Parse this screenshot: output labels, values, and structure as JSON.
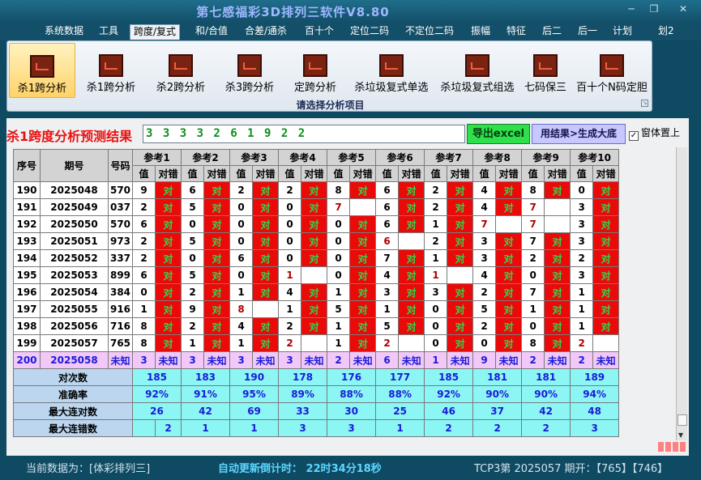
{
  "window": {
    "title": "第七感福彩3D排列三软件V8.80",
    "min": "─",
    "restore": "❐",
    "close": "✕"
  },
  "menu": [
    "系统数据",
    "工具",
    "跨度/复式",
    "和/合值",
    "合差/通杀",
    "百十个",
    "定位二码",
    "不定位二码",
    "振幅",
    "特征",
    "后二",
    "后一",
    "计划",
    "划2"
  ],
  "ribbon": {
    "items": [
      "杀1跨分析",
      "杀1跨分析",
      "杀2跨分析",
      "杀3跨分析",
      "定跨分析",
      "杀垃圾复式单选",
      "杀垃圾复式组选",
      "七码保三",
      "百十个N码定胆"
    ],
    "caption": "请选择分析项目",
    "icon": "chart-icon"
  },
  "result": {
    "title": "杀1跨度分析预测结果",
    "value": "3 3 3 3 2 6 1 9 2 2",
    "excel_label": "导出excel",
    "gen_label": "用结果>生成大底",
    "topmost_label": "窗体置上",
    "topmost_check": "✓"
  },
  "table": {
    "headers": {
      "seq": "序号",
      "issue": "期号",
      "num": "号码",
      "val": "值",
      "check": "对错"
    },
    "refs": [
      "参考1",
      "参考2",
      "参考3",
      "参考4",
      "参考5",
      "参考6",
      "参考7",
      "参考8",
      "参考9",
      "参考10"
    ],
    "hit_label": "对",
    "rows": [
      {
        "seq": "190",
        "issue": "2025048",
        "num": "570",
        "vals": [
          "9",
          "6",
          "2",
          "2",
          "8",
          "6",
          "2",
          "4",
          "8",
          "0"
        ],
        "hits": [
          1,
          1,
          1,
          1,
          1,
          1,
          1,
          1,
          1,
          1
        ]
      },
      {
        "seq": "191",
        "issue": "2025049",
        "num": "037",
        "vals": [
          "2",
          "5",
          "0",
          "0",
          "7",
          "6",
          "2",
          "4",
          "7",
          "3"
        ],
        "hits": [
          1,
          1,
          1,
          1,
          0,
          1,
          1,
          1,
          0,
          1
        ]
      },
      {
        "seq": "192",
        "issue": "2025050",
        "num": "570",
        "vals": [
          "6",
          "0",
          "0",
          "0",
          "0",
          "6",
          "1",
          "7",
          "7",
          "3"
        ],
        "hits": [
          1,
          1,
          1,
          1,
          1,
          1,
          1,
          0,
          0,
          1
        ]
      },
      {
        "seq": "193",
        "issue": "2025051",
        "num": "973",
        "vals": [
          "2",
          "5",
          "0",
          "0",
          "0",
          "6",
          "2",
          "3",
          "7",
          "3"
        ],
        "hits": [
          1,
          1,
          1,
          1,
          1,
          0,
          1,
          1,
          1,
          1
        ]
      },
      {
        "seq": "194",
        "issue": "2025052",
        "num": "337",
        "vals": [
          "2",
          "0",
          "6",
          "0",
          "0",
          "7",
          "1",
          "3",
          "2",
          "2"
        ],
        "hits": [
          1,
          1,
          1,
          1,
          1,
          1,
          1,
          1,
          1,
          1
        ]
      },
      {
        "seq": "195",
        "issue": "2025053",
        "num": "899",
        "vals": [
          "6",
          "5",
          "0",
          "1",
          "0",
          "4",
          "1",
          "4",
          "0",
          "3"
        ],
        "hits": [
          1,
          1,
          1,
          0,
          1,
          1,
          0,
          1,
          1,
          1
        ]
      },
      {
        "seq": "196",
        "issue": "2025054",
        "num": "384",
        "vals": [
          "0",
          "2",
          "1",
          "4",
          "1",
          "3",
          "3",
          "2",
          "7",
          "1"
        ],
        "hits": [
          1,
          1,
          1,
          1,
          1,
          1,
          1,
          1,
          1,
          1
        ]
      },
      {
        "seq": "197",
        "issue": "2025055",
        "num": "916",
        "vals": [
          "1",
          "9",
          "8",
          "1",
          "5",
          "1",
          "0",
          "5",
          "1",
          "1"
        ],
        "hits": [
          1,
          1,
          0,
          1,
          1,
          1,
          1,
          1,
          1,
          1
        ]
      },
      {
        "seq": "198",
        "issue": "2025056",
        "num": "716",
        "vals": [
          "8",
          "2",
          "4",
          "2",
          "1",
          "5",
          "0",
          "2",
          "0",
          "1"
        ],
        "hits": [
          1,
          1,
          1,
          1,
          1,
          1,
          1,
          1,
          1,
          1
        ]
      },
      {
        "seq": "199",
        "issue": "2025057",
        "num": "765",
        "vals": [
          "8",
          "1",
          "1",
          "2",
          "1",
          "2",
          "0",
          "0",
          "8",
          "2"
        ],
        "hits": [
          1,
          1,
          1,
          0,
          1,
          0,
          1,
          1,
          1,
          0
        ]
      }
    ],
    "pred": {
      "seq": "200",
      "issue": "2025058",
      "num": "未知",
      "vals": [
        "3",
        "3",
        "3",
        "3",
        "2",
        "6",
        "1",
        "9",
        "2",
        "2"
      ],
      "check": "未知"
    },
    "stats": [
      {
        "label": "对次数",
        "vals": [
          "185",
          "183",
          "190",
          "178",
          "176",
          "177",
          "185",
          "181",
          "181",
          "189"
        ]
      },
      {
        "label": "准确率",
        "vals": [
          "92%",
          "91%",
          "95%",
          "89%",
          "88%",
          "88%",
          "92%",
          "90%",
          "90%",
          "94%"
        ]
      },
      {
        "label": "最大连对数",
        "vals": [
          "26",
          "42",
          "69",
          "33",
          "30",
          "25",
          "46",
          "37",
          "42",
          "48"
        ]
      },
      {
        "label": "最大连错数",
        "vals": [
          "2",
          "1",
          "1",
          "3",
          "3",
          "1",
          "2",
          "2",
          "2",
          "3"
        ]
      }
    ]
  },
  "status": {
    "data": "当前数据为：[体彩排列三]",
    "timer": "自动更新倒计时：  22时34分18秒",
    "draw": "TCP3第 2025057 期开：【765】【746】"
  },
  "colors": {
    "hit": "#ea0a0a",
    "hit_text": "#2fd84a",
    "pred_row": "#f2c8f8",
    "stat_row": "#8bf6f3"
  }
}
